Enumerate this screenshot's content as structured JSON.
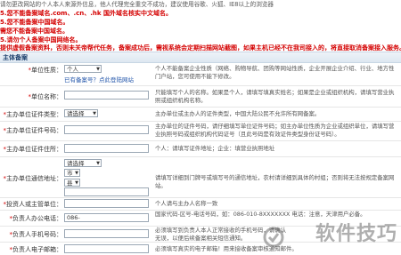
{
  "notice": {
    "line0": "请勿更改网站的个人本人来源外信息，他人代理完全重交不成功，建议使用谷歌、火狐、IE8以上的浏览器",
    "line1": "5.您不能备案域名.com、.cn、.hk 国外域名核实中文域名。",
    "line2": "5.您不能备案中国域名。",
    "line3": "需您不能备案中国域名。",
    "line4": "5.请勿个人备案中国网络名。",
    "line5": "提供虚假备案资料，否则未关帝帮代任务，备案成功后，需视系统会定期扫描网站截图，如果主机已经不在我司接入的，将直接取消备案接入服务。"
  },
  "section_title": "主体备案",
  "form": {
    "unit_nature": {
      "label": "单位性质：",
      "value": "个人",
      "link": "已有备案号？点此登陆网站",
      "hint": "个人不能备案企业性质（网络、购物导航、团购等网站性质，企业开展企业介绍、行业、地方性门户站，您可使用不能下修改。"
    },
    "unit_name": {
      "label": "单位名称：",
      "value": "",
      "hint": "只能填写个人的名称。如果是个人，请填写填真实姓名；如果是企业或组织机构，请填写营业执照或组织机构名称。"
    },
    "cert_type": {
      "label": "主办单位证件类型：",
      "value": "请选择",
      "hint": "主办单位或主办人的证件类型，中国大陆公民不允许所有网备案。"
    },
    "cert_no": {
      "label": "主办单位证件号码：",
      "value": "",
      "hint": "主办单位的证件号码，请仔细填写单位证件号码；如主办单位性质为企业或组织单位，请填写营业执照号码或组织机构代码证号（且此号码是有效证件类型身份证号码）。"
    },
    "cert_addr": {
      "label": "主办单位证件住所：",
      "value": "",
      "hint": "个人：请填写证件地址；企业：填营业执照地址"
    },
    "comm_addr": {
      "label": "主办单位通信地址：",
      "province": "请选择",
      "city": "市",
      "district": "县",
      "value": "",
      "hint": "请填写详细到门牌号或填写号的通信地址，农村请详细到具体的村组；否则将无法按规定备案网站。"
    },
    "investor": {
      "label": "投资人或主管单位：",
      "value": "",
      "hint": "个人请与主办人名称一致"
    },
    "office_phone": {
      "label": "负责人办公电话：",
      "value": "086-",
      "hint": "国家代码-区号-电话号码，如：086-010-8XXXXXXX 电话：注意，天津用户必备。"
    },
    "mobile": {
      "label": "负责人手机号码：",
      "value": "",
      "hint": "必须填写到负责人本人正常接收的手机号码，请确认无误，以便后续备案相关短信通知。"
    },
    "email": {
      "label": "负责人电子邮箱：",
      "value": "",
      "hint": "必须填写真实的电子邮箱！用来接收备案审核通知邮件。"
    }
  },
  "watermark": "软件技巧"
}
